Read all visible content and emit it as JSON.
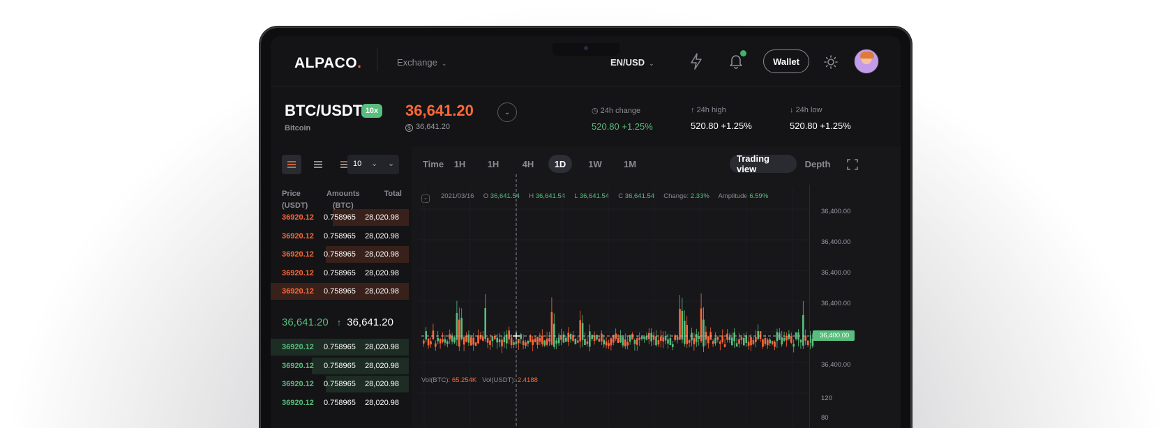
{
  "header": {
    "logo": "ALPACO",
    "logo_dot": ".",
    "exchange_label": "Exchange",
    "currency": "EN/USD",
    "wallet_label": "Wallet"
  },
  "pair": {
    "symbol": "BTC/USDT",
    "leverage": "10x",
    "name": "Bitcoin",
    "price": "36,641.20",
    "price_sub": "36,641.20",
    "stats": [
      {
        "label": "24h change",
        "value": "520.80 +1.25%",
        "color": "#58bd7d"
      },
      {
        "label": "24h high",
        "value": "520.80 +1.25%",
        "color": "#ffffff"
      },
      {
        "label": "24h low",
        "value": "520.80 +1.25%",
        "color": "#ffffff"
      }
    ]
  },
  "orderbook": {
    "depth_select": "10",
    "headers": {
      "price": "Price",
      "price_unit": "(USDT)",
      "amounts": "Amounts",
      "amounts_unit": "(BTC)",
      "total": "Total"
    },
    "asks": [
      {
        "price": "36920.12",
        "amount": "0.758965",
        "total": "28,020.98",
        "depth": 0.55
      },
      {
        "price": "36920.12",
        "amount": "0.758965",
        "total": "28,020.98",
        "depth": 0.0
      },
      {
        "price": "36920.12",
        "amount": "0.758965",
        "total": "28,020.98",
        "depth": 0.6
      },
      {
        "price": "36920.12",
        "amount": "0.758965",
        "total": "28,020.98",
        "depth": 0.0
      },
      {
        "price": "36920.12",
        "amount": "0.758965",
        "total": "28,020.98",
        "depth": 1.0
      }
    ],
    "mid_price_a": "36,641.20",
    "mid_price_b": "36,641.20",
    "bids": [
      {
        "price": "36920.12",
        "amount": "0.758965",
        "total": "28,020.98",
        "depth": 1.0
      },
      {
        "price": "36920.12",
        "amount": "0.758965",
        "total": "28,020.98",
        "depth": 0.7
      },
      {
        "price": "36920.12",
        "amount": "0.758965",
        "total": "28,020.98",
        "depth": 0.6
      },
      {
        "price": "36920.12",
        "amount": "0.758965",
        "total": "28,020.98",
        "depth": 0.0
      }
    ]
  },
  "chart_tabs": {
    "time_label": "Time",
    "intervals": [
      "1H",
      "1H",
      "4H",
      "1D",
      "1W",
      "1M"
    ],
    "active_interval": "1D",
    "trading_view": "Trading view",
    "depth": "Depth"
  },
  "ohlc": {
    "date": "2021/03/16",
    "o_label": "O",
    "o": "36,641.54",
    "h_label": "H",
    "h": "36,641.54",
    "l_label": "L",
    "l": "36,641.54",
    "c_label": "C",
    "c": "36,641.54",
    "change_label": "Change:",
    "change": "2.33%",
    "amplitude_label": "Amplitude",
    "amplitude": "6.59%"
  },
  "volume": {
    "btc_label": "Vol(BTC):",
    "btc": "65.254K",
    "usdt_label": "Vol(USDT):",
    "usdt": "2.4188"
  },
  "y_axis": {
    "labels": [
      "36,400.00",
      "36,400.00",
      "36,400.00",
      "36,400.00",
      "36,400.00",
      "36,400.00"
    ],
    "highlight_index": 4,
    "volume_labels": [
      "120",
      "80"
    ]
  },
  "colors": {
    "up": "#58bd7d",
    "down": "#ff6838",
    "bg": "#141416"
  }
}
